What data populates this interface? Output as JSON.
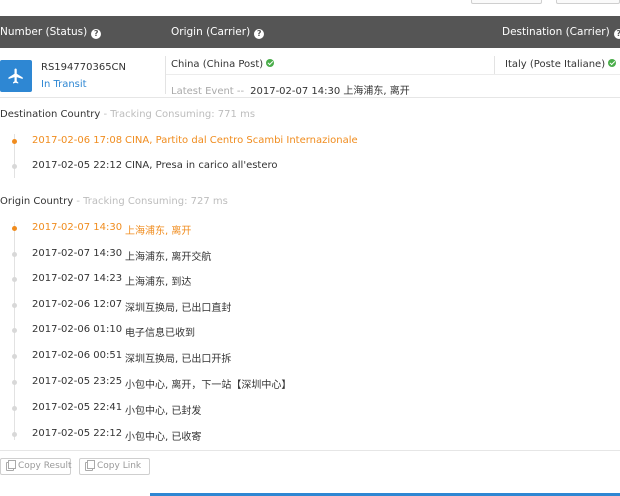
{
  "header": {
    "number_status": "Number (Status)",
    "origin_carrier": "Origin (Carrier)",
    "destination_carrier": "Destination (Carrier)",
    "help_glyph": "?"
  },
  "summary": {
    "tracking_number": "RS194770365CN",
    "status": "In Transit",
    "origin": "China (China Post)",
    "destination": "Italy (Poste Italiane)",
    "latest_event_label": "Latest Event --",
    "latest_event_value": "2017-02-07 14:30 上海浦东, 离开",
    "carrier_icon": "airplane-icon"
  },
  "destination_section": {
    "title": "Destination Country",
    "meta": " - Tracking Consuming: 771 ms",
    "events": [
      {
        "time": "2017-02-06 17:08",
        "desc": "CINA, Partito dal Centro Scambi Internazionale",
        "latest": true
      },
      {
        "time": "2017-02-05 22:12",
        "desc": "CINA, Presa in carico all'estero",
        "latest": false
      }
    ]
  },
  "origin_section": {
    "title": "Origin Country",
    "meta": " - Tracking Consuming: 727 ms",
    "events": [
      {
        "time": "2017-02-07 14:30",
        "desc": "上海浦东, 离开",
        "latest": true
      },
      {
        "time": "2017-02-07 14:30",
        "desc": "上海浦东, 离开交航",
        "latest": false
      },
      {
        "time": "2017-02-07 14:23",
        "desc": "上海浦东, 到达",
        "latest": false
      },
      {
        "time": "2017-02-06 12:07",
        "desc": "深圳互换局, 已出口直封",
        "latest": false
      },
      {
        "time": "2017-02-06 01:10",
        "desc": "电子信息已收到",
        "latest": false
      },
      {
        "time": "2017-02-06 00:51",
        "desc": "深圳互换局, 已出口开拆",
        "latest": false
      },
      {
        "time": "2017-02-05 23:25",
        "desc": "小包中心, 离开，下一站【深圳中心】",
        "latest": false
      },
      {
        "time": "2017-02-05 22:41",
        "desc": "小包中心, 已封发",
        "latest": false
      },
      {
        "time": "2017-02-05 22:12",
        "desc": "小包中心, 已收寄",
        "latest": false
      }
    ]
  },
  "footer": {
    "copy_result": "Copy Result",
    "copy_link": "Copy Link"
  },
  "colors": {
    "header_bg": "#555555",
    "accent_blue": "#2e87d3",
    "latest_orange": "#f08c1e",
    "ok_green": "#4aad4a"
  }
}
